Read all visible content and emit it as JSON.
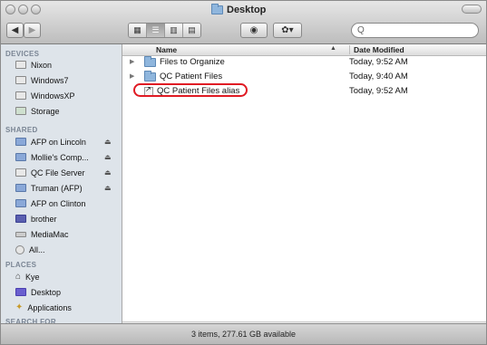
{
  "window": {
    "title": "Desktop"
  },
  "toolbar": {
    "search_placeholder": "Q"
  },
  "sidebar": {
    "devices_title": "DEVICES",
    "devices": [
      {
        "label": "Nixon",
        "icon": "hard-drive-icon"
      },
      {
        "label": "Windows7",
        "icon": "hard-drive-icon"
      },
      {
        "label": "WindowsXP",
        "icon": "hard-drive-icon"
      },
      {
        "label": "Storage",
        "icon": "hard-drive-icon"
      }
    ],
    "shared_title": "SHARED",
    "shared": [
      {
        "label": "AFP on Lincoln",
        "icon": "network-computer-icon",
        "eject": true
      },
      {
        "label": "Mollie's Comp...",
        "icon": "network-computer-icon",
        "eject": true
      },
      {
        "label": "QC File Server",
        "icon": "server-icon",
        "eject": true
      },
      {
        "label": "Truman (AFP)",
        "icon": "network-computer-icon",
        "eject": true
      },
      {
        "label": "AFP on Clinton",
        "icon": "network-computer-icon",
        "eject": false
      },
      {
        "label": "brother",
        "icon": "printer-icon",
        "eject": false
      },
      {
        "label": "MediaMac",
        "icon": "display-icon",
        "eject": false
      },
      {
        "label": "All...",
        "icon": "globe-icon",
        "eject": false
      }
    ],
    "places_title": "PLACES",
    "places": [
      {
        "label": "Kye",
        "icon": "home-icon"
      },
      {
        "label": "Desktop",
        "icon": "desktop-icon"
      },
      {
        "label": "Applications",
        "icon": "applications-icon"
      }
    ],
    "search_title": "SEARCH FOR"
  },
  "list": {
    "columns": {
      "name": "Name",
      "date": "Date Modified"
    },
    "rows": [
      {
        "name": "Files to Organize",
        "date": "Today, 9:52 AM",
        "type": "folder"
      },
      {
        "name": "QC Patient Files",
        "date": "Today, 9:40 AM",
        "type": "folder"
      },
      {
        "name": "QC Patient Files alias",
        "date": "Today, 9:52 AM",
        "type": "alias"
      }
    ]
  },
  "status": {
    "text": "3 items, 277.61 GB available"
  },
  "colors": {
    "highlight": "#e01b24",
    "sidebar_bg": "#dee4ea"
  }
}
